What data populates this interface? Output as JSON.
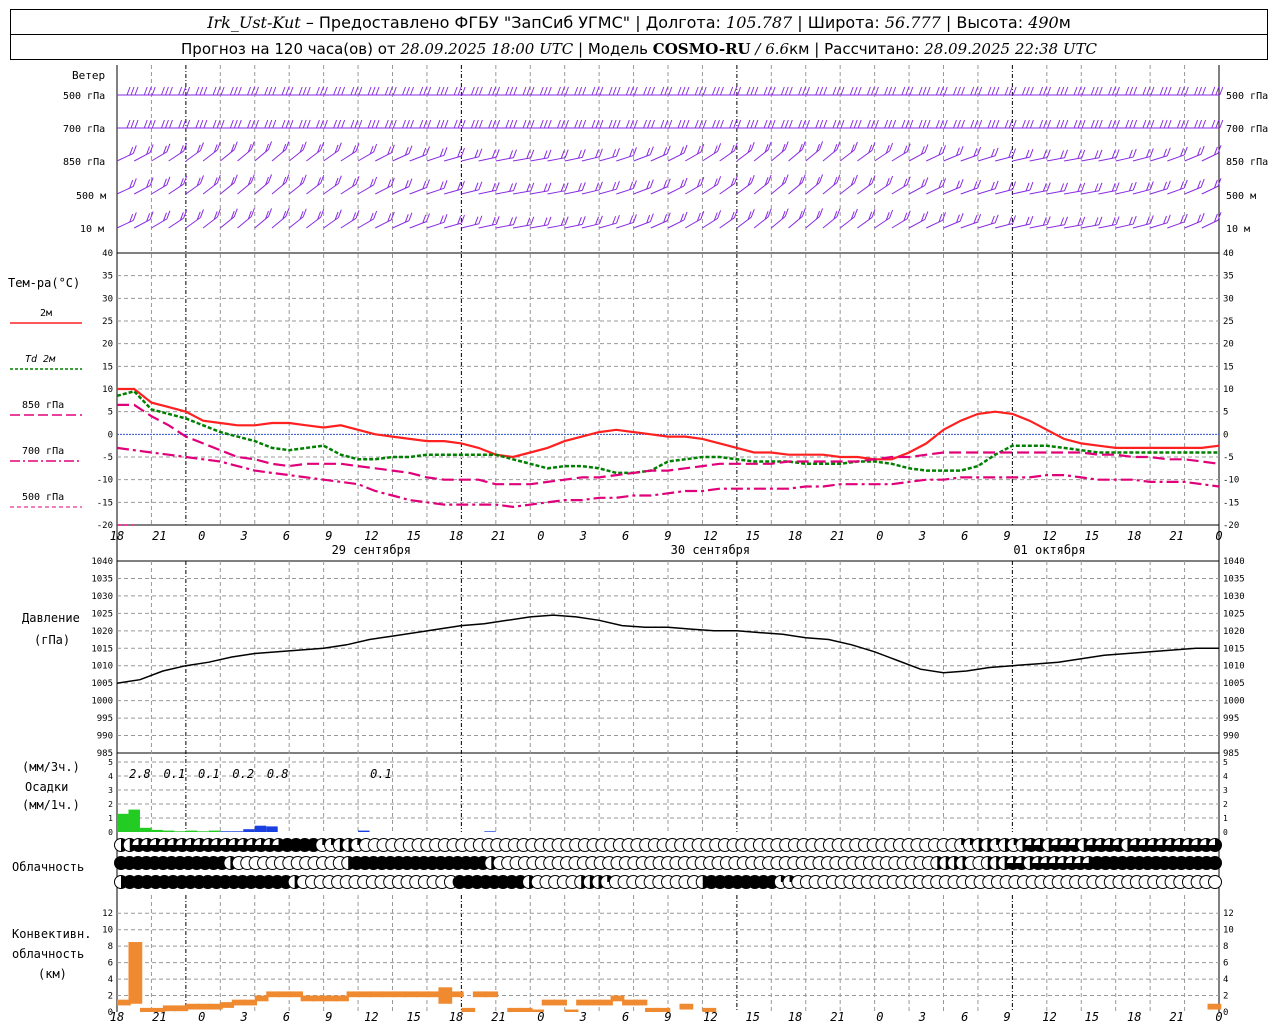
{
  "header": {
    "station": "Irk_Ust-Kut",
    "provided": "– Предоставлено ФГБУ \"ЗапСиб УГМС\"",
    "lon_label": "Долгота:",
    "lon": "105.787",
    "lat_label": "Широта:",
    "lat": "56.777",
    "alt_label": "Высота:",
    "alt": "490",
    "alt_unit": "м",
    "forecast_label": "Прогноз на 120 часа(ов) от",
    "issued": "28.09.2025 18:00 UTC",
    "model_label": "Модель",
    "model": "COSMO-RU",
    "resolution": "/ 6.6",
    "res_unit": "км",
    "calc_label": "Рассчитано:",
    "calc_time": "28.09.2025 22:38 UTC"
  },
  "labels": {
    "wind": "Ветер",
    "wind_levels": [
      "500 гПа",
      "700 гПа",
      "850 гПа",
      "500  м",
      "10  м"
    ],
    "temp": "Тем-ра(°C)",
    "temp_legend": [
      "2м",
      "Td  2м",
      "850 гПа",
      "700 гПа",
      "500 гПа"
    ],
    "pressure": [
      "Давление",
      "(гПа)"
    ],
    "precip": [
      "(мм/3ч.)",
      "Осадки",
      "(мм/1ч.)"
    ],
    "cloud": "Облачность",
    "conv": [
      "Конвективн.",
      "облачность",
      "(км)"
    ]
  },
  "colors": {
    "wind": "#8a2be2",
    "t2m": "#ff2020",
    "td2m": "#008000",
    "t850": "#e0007a",
    "t700": "#e0007a",
    "t500": "#e0007a",
    "pressure": "#000000",
    "precip_rain": "#22cc22",
    "precip_snow": "#1a3fe0",
    "conv": "#f08a30",
    "grid": "#999999"
  },
  "chart_data": [
    {
      "type": "line",
      "name": "temperature",
      "xlabel": "",
      "x_hours": [
        0,
        1.5,
        3,
        4.5,
        6,
        7.5,
        9,
        10.5,
        12,
        13.5,
        15,
        16.5,
        18,
        19.5,
        21,
        22.5,
        24,
        25.5,
        27,
        28.5,
        30,
        31.5,
        33,
        34.5,
        36,
        37.5,
        39,
        40.5,
        42,
        43.5,
        45,
        46.5,
        48,
        49.5,
        51,
        52.5,
        54,
        55.5,
        57,
        58.5,
        60,
        61.5,
        63,
        64.5,
        66,
        67.5,
        69,
        70.5,
        72,
        73.5,
        75,
        76.5,
        78,
        79.5,
        81,
        82.5,
        84,
        85.5,
        87,
        88.5,
        90,
        91.5,
        93,
        94.5,
        96
      ],
      "ylim": [
        -20,
        40
      ],
      "series": [
        {
          "name": "2м",
          "style": "solid",
          "values": [
            10,
            10,
            7,
            6,
            5,
            3,
            2.5,
            2,
            2,
            2.5,
            2.5,
            2,
            1.5,
            2,
            1,
            0,
            -0.5,
            -1,
            -1.5,
            -1.5,
            -2,
            -3,
            -4.5,
            -5,
            -4,
            -3,
            -1.5,
            -0.5,
            0.5,
            1,
            0.5,
            0,
            -0.5,
            -0.5,
            -1,
            -2,
            -3,
            -4,
            -4,
            -4.5,
            -4.5,
            -4.5,
            -5,
            -5,
            -5.5,
            -5.5,
            -4,
            -2,
            1,
            3,
            4.5,
            5,
            4.5,
            3,
            1,
            -1,
            -2,
            -2.5,
            -3,
            -3,
            -3,
            -3,
            -3,
            -3,
            -2.5
          ]
        },
        {
          "name": "Td  2м",
          "style": "dash",
          "values": [
            8.5,
            9.5,
            5.5,
            4.5,
            3.5,
            2,
            0.5,
            -0.5,
            -1.5,
            -3,
            -3.5,
            -3,
            -2.5,
            -4.5,
            -5.5,
            -5.5,
            -5,
            -5,
            -4.5,
            -4.5,
            -4.5,
            -4.5,
            -4.5,
            -5.5,
            -6.5,
            -7.5,
            -7,
            -7,
            -7.5,
            -8.5,
            -8.5,
            -8,
            -6,
            -5.5,
            -5,
            -5,
            -5.5,
            -6,
            -6,
            -6,
            -6.5,
            -6.5,
            -6.5,
            -6,
            -6,
            -6.5,
            -7.5,
            -8,
            -8,
            -8,
            -7,
            -4.5,
            -2.5,
            -2.5,
            -2.5,
            -3,
            -3.5,
            -4,
            -4,
            -4,
            -4,
            -4,
            -4,
            -4,
            -4
          ]
        },
        {
          "name": "850 гПа",
          "style": "longdash",
          "values": [
            6.5,
            6.5,
            4,
            2,
            -0.5,
            -2,
            -3.5,
            -5,
            -5.5,
            -6.5,
            -7,
            -6.5,
            -6.5,
            -6.5,
            -7,
            -7.5,
            -8,
            -8.5,
            -9.5,
            -10,
            -10,
            -10,
            -11,
            -11,
            -11,
            -10.5,
            -10,
            -9.5,
            -9.5,
            -9,
            -8.5,
            -8,
            -8,
            -7.5,
            -7,
            -6.5,
            -6.5,
            -6.5,
            -6.5,
            -6,
            -6,
            -6,
            -6,
            -6,
            -5.5,
            -5,
            -5,
            -4.5,
            -4,
            -4,
            -4,
            -4,
            -4,
            -4,
            -4,
            -4,
            -4,
            -4.5,
            -4.5,
            -5,
            -5,
            -5.5,
            -5.5,
            -6,
            -6.5
          ]
        },
        {
          "name": "700 гПа",
          "style": "dashdot",
          "values": [
            -3,
            -3.5,
            -4,
            -4.5,
            -5,
            -5.5,
            -6,
            -7,
            -8,
            -8.5,
            -9,
            -9.5,
            -10,
            -10.5,
            -11,
            -12.5,
            -13.5,
            -14.5,
            -15,
            -15.5,
            -15.5,
            -15.5,
            -15.5,
            -16,
            -15.5,
            -15,
            -14.5,
            -14.5,
            -14,
            -14,
            -13.5,
            -13.5,
            -13,
            -12.5,
            -12.5,
            -12,
            -12,
            -12,
            -12,
            -12,
            -11.5,
            -11.5,
            -11,
            -11,
            -11,
            -11,
            -10.5,
            -10,
            -10,
            -9.5,
            -9.5,
            -9.5,
            -9.5,
            -9.5,
            -9,
            -9,
            -9.5,
            -10,
            -10,
            -10,
            -10.5,
            -10.5,
            -10.5,
            -11,
            -11.5
          ]
        },
        {
          "name": "500 гПа",
          "style": "shortdash",
          "values": [
            -20,
            -20
          ]
        }
      ]
    },
    {
      "type": "line",
      "name": "pressure",
      "ylabel": "Давление (гПа)",
      "ylim": [
        985,
        1040
      ],
      "x_hours": [
        0,
        2,
        4,
        6,
        8,
        10,
        12,
        14,
        16,
        18,
        20,
        22,
        24,
        26,
        28,
        30,
        32,
        34,
        36,
        38,
        40,
        42,
        44,
        46,
        48,
        50,
        52,
        54,
        56,
        58,
        60,
        62,
        64,
        66,
        68,
        70,
        72,
        74,
        76,
        78,
        80,
        82,
        84,
        86,
        88,
        90,
        92,
        94,
        96
      ],
      "values": [
        1005,
        1006,
        1008.5,
        1010,
        1011,
        1012.5,
        1013.5,
        1014,
        1014.5,
        1015,
        1016,
        1017.5,
        1018.5,
        1019.5,
        1020.5,
        1021.5,
        1022,
        1023,
        1024,
        1024.5,
        1024,
        1023,
        1021.5,
        1021,
        1021,
        1020.5,
        1020,
        1020,
        1019.5,
        1019,
        1018,
        1017.5,
        1016,
        1014,
        1011.5,
        1009,
        1008,
        1008.5,
        1009.5,
        1010,
        1010.5,
        1011,
        1012,
        1013,
        1013.5,
        1014,
        1014.5,
        1015,
        1015
      ]
    },
    {
      "type": "bar",
      "name": "precipitation",
      "ylim": [
        0,
        5
      ],
      "annotations": [
        {
          "label": "2.8",
          "hour": 1.5
        },
        {
          "label": "0.1",
          "hour": 4.5
        },
        {
          "label": "0.1",
          "hour": 7.5
        },
        {
          "label": "0.2",
          "hour": 10.5
        },
        {
          "label": "0.8",
          "hour": 13.5
        },
        {
          "label": "0.1",
          "hour": 22.5
        }
      ],
      "bars": [
        {
          "hour": 0,
          "value": 1.3,
          "kind": "rain"
        },
        {
          "hour": 1,
          "value": 1.6,
          "kind": "rain"
        },
        {
          "hour": 2,
          "value": 0.3,
          "kind": "rain"
        },
        {
          "hour": 3,
          "value": 0.15,
          "kind": "rain"
        },
        {
          "hour": 4,
          "value": 0.1,
          "kind": "rain"
        },
        {
          "hour": 5,
          "value": 0.05,
          "kind": "rain"
        },
        {
          "hour": 6,
          "value": 0.1,
          "kind": "rain"
        },
        {
          "hour": 7,
          "value": 0.05,
          "kind": "rain"
        },
        {
          "hour": 8,
          "value": 0.1,
          "kind": "rain"
        },
        {
          "hour": 9,
          "value": 0.05,
          "kind": "snow"
        },
        {
          "hour": 10,
          "value": 0.05,
          "kind": "snow"
        },
        {
          "hour": 11,
          "value": 0.2,
          "kind": "snow"
        },
        {
          "hour": 12,
          "value": 0.45,
          "kind": "snow"
        },
        {
          "hour": 13,
          "value": 0.4,
          "kind": "snow"
        },
        {
          "hour": 21,
          "value": 0.1,
          "kind": "snow"
        },
        {
          "hour": 32,
          "value": 0.05,
          "kind": "snow"
        }
      ]
    },
    {
      "type": "bar",
      "name": "convective_cloud",
      "ylabel": "Конвективн. облачность (км)",
      "ylim": [
        0,
        13
      ],
      "bars": [
        {
          "hour": 0,
          "value": 1.5
        },
        {
          "hour": 1,
          "value": 8.5
        },
        {
          "hour": 2,
          "value": 0.5
        },
        {
          "hour": 3,
          "value": 0.5
        },
        {
          "hour": 4,
          "value": 0.8
        },
        {
          "hour": 5,
          "value": 0.8
        },
        {
          "hour": 6,
          "value": 1
        },
        {
          "hour": 7,
          "value": 1
        },
        {
          "hour": 8,
          "value": 1
        },
        {
          "hour": 9,
          "value": 1.2
        },
        {
          "hour": 10,
          "value": 1.5
        },
        {
          "hour": 11,
          "value": 1.5
        },
        {
          "hour": 12,
          "value": 2
        },
        {
          "hour": 13,
          "value": 2.5
        },
        {
          "hour": 14,
          "value": 2.5
        },
        {
          "hour": 15,
          "value": 2.5
        },
        {
          "hour": 16,
          "value": 2
        },
        {
          "hour": 17,
          "value": 2
        },
        {
          "hour": 18,
          "value": 2
        },
        {
          "hour": 19,
          "value": 2
        },
        {
          "hour": 20,
          "value": 2.5
        },
        {
          "hour": 21,
          "value": 2.5
        },
        {
          "hour": 22,
          "value": 2.5
        },
        {
          "hour": 23,
          "value": 2.5
        },
        {
          "hour": 24,
          "value": 2.5
        },
        {
          "hour": 25,
          "value": 2.5
        },
        {
          "hour": 26,
          "value": 2.5
        },
        {
          "hour": 27,
          "value": 2.5
        },
        {
          "hour": 28,
          "value": 3
        },
        {
          "hour": 29,
          "value": 2.5
        },
        {
          "hour": 30,
          "value": 0.5
        },
        {
          "hour": 31,
          "value": 2.5
        },
        {
          "hour": 32,
          "value": 2.5
        },
        {
          "hour": 34,
          "value": 0.5
        },
        {
          "hour": 35,
          "value": 0.5
        },
        {
          "hour": 36,
          "value": 0.3
        },
        {
          "hour": 37,
          "value": 1.5
        },
        {
          "hour": 38,
          "value": 1.5
        },
        {
          "hour": 39,
          "value": 0.3
        },
        {
          "hour": 40,
          "value": 1.5
        },
        {
          "hour": 41,
          "value": 1.5
        },
        {
          "hour": 42,
          "value": 1.5
        },
        {
          "hour": 43,
          "value": 2
        },
        {
          "hour": 44,
          "value": 1.5
        },
        {
          "hour": 45,
          "value": 1.5
        },
        {
          "hour": 46,
          "value": 0.5
        },
        {
          "hour": 47,
          "value": 0.5
        },
        {
          "hour": 49,
          "value": 1
        },
        {
          "hour": 51,
          "value": 0.5
        },
        {
          "hour": 95,
          "value": 1
        }
      ]
    }
  ],
  "time_axis": {
    "ticks": [
      "18",
      "21",
      "0",
      "3",
      "6",
      "9",
      "12",
      "15",
      "18",
      "21",
      "0",
      "3",
      "6",
      "9",
      "12",
      "15",
      "18",
      "21",
      "0",
      "3",
      "6",
      "9",
      "12",
      "15",
      "18",
      "21",
      "0"
    ],
    "dates": [
      {
        "label": "29 сентября",
        "tick": 6
      },
      {
        "label": "30 сентября",
        "tick": 14
      },
      {
        "label": "01 октября",
        "tick": 22
      }
    ],
    "midnight_ticks": [
      2,
      10,
      18,
      26
    ]
  },
  "cloud_rows": {
    "rows": [
      "low",
      "mid",
      "high"
    ],
    "fractions": [
      [
        0.5,
        0.5,
        0.75,
        0.75,
        0.75,
        0.75,
        0.75,
        0.75,
        0.75,
        0.75,
        0.75,
        0.75,
        0.75,
        0.75,
        0.75,
        0.75,
        0.75,
        0.75,
        0.75,
        1,
        1,
        1,
        1,
        0.25,
        0.25,
        0.5,
        0.5,
        0.25,
        0,
        0,
        0,
        0,
        0,
        0,
        0,
        0,
        0,
        0,
        0,
        0,
        0,
        0,
        0,
        0,
        0,
        0,
        0,
        0,
        0,
        0,
        0,
        0,
        0,
        0,
        0,
        0,
        0,
        0,
        0,
        0,
        0,
        0,
        0,
        0,
        0,
        0,
        0,
        0,
        0,
        0,
        0,
        0,
        0,
        0,
        0,
        0,
        0,
        0,
        0,
        0,
        0,
        0,
        0,
        0,
        0,
        0,
        0,
        0,
        0,
        0,
        0,
        0,
        0,
        0,
        0,
        0,
        0.25,
        0.25,
        0.5,
        0.5,
        0.25,
        0.5,
        0.25,
        0.5,
        0.75,
        0.75,
        0.5,
        0.75,
        0.75,
        0.75,
        0.5,
        0.75,
        0.75,
        0.75,
        0.75,
        0.5,
        0.75,
        0.75,
        0.75,
        0.75,
        0.75,
        0.75,
        0.75,
        0.75,
        0.75,
        0.75
      ],
      [
        1,
        1,
        1,
        1,
        1,
        1,
        1,
        1,
        1,
        1,
        1,
        1,
        1,
        0.5,
        0,
        0,
        0,
        0,
        0,
        0,
        0,
        0,
        0,
        0,
        0,
        0,
        0,
        0.5,
        1,
        1,
        1,
        1,
        1,
        1,
        1,
        1,
        1,
        1,
        1,
        1,
        1,
        1,
        1,
        1,
        0.5,
        0,
        0,
        0,
        0,
        0,
        0,
        0,
        0,
        0,
        0,
        0,
        0,
        0,
        0,
        0,
        0,
        0,
        0,
        0,
        0,
        0,
        0,
        0,
        0,
        0,
        0,
        0,
        0,
        0,
        0,
        0,
        0,
        0,
        0,
        0,
        0,
        0,
        0,
        0,
        0,
        0,
        0,
        0,
        0,
        0,
        0,
        0,
        0,
        0,
        0,
        0,
        0,
        0.5,
        0.5,
        0.5,
        0.5,
        0,
        0,
        0.5,
        0.5,
        0.5,
        0.75,
        0.75,
        0.5,
        0.75,
        0.75,
        0.75,
        0.75,
        0.75,
        0.75,
        0.75,
        1,
        1,
        1,
        1,
        1,
        1,
        1,
        1,
        1,
        1,
        1,
        1,
        1,
        1,
        1
      ],
      [
        0.5,
        1,
        1,
        1,
        1,
        1,
        1,
        1,
        1,
        1,
        1,
        1,
        1,
        1,
        1,
        1,
        1,
        1,
        1,
        1,
        0.5,
        0,
        0,
        0,
        0,
        0,
        0,
        0,
        0,
        0,
        0,
        0,
        0,
        0,
        0,
        0,
        0,
        0,
        0,
        1,
        1,
        1,
        1,
        1,
        1,
        1,
        1,
        0.5,
        0,
        0,
        0,
        0,
        0,
        0.5,
        0.5,
        0.5,
        0.25,
        0,
        0,
        0,
        0,
        0,
        0,
        0,
        0,
        0,
        0,
        0.5,
        1,
        1,
        1,
        1,
        1,
        1,
        1,
        1,
        0.25,
        0.25,
        0,
        0,
        0,
        0,
        0,
        0,
        0,
        0,
        0,
        0,
        0,
        0,
        0,
        0,
        0,
        0,
        0,
        0,
        0,
        0,
        0,
        0,
        0,
        0,
        0,
        0,
        0,
        0,
        0,
        0,
        0,
        0,
        0,
        0,
        0,
        0,
        0,
        0,
        0,
        0,
        0,
        0,
        0,
        0,
        0,
        0,
        0,
        0,
        0
      ]
    ]
  }
}
